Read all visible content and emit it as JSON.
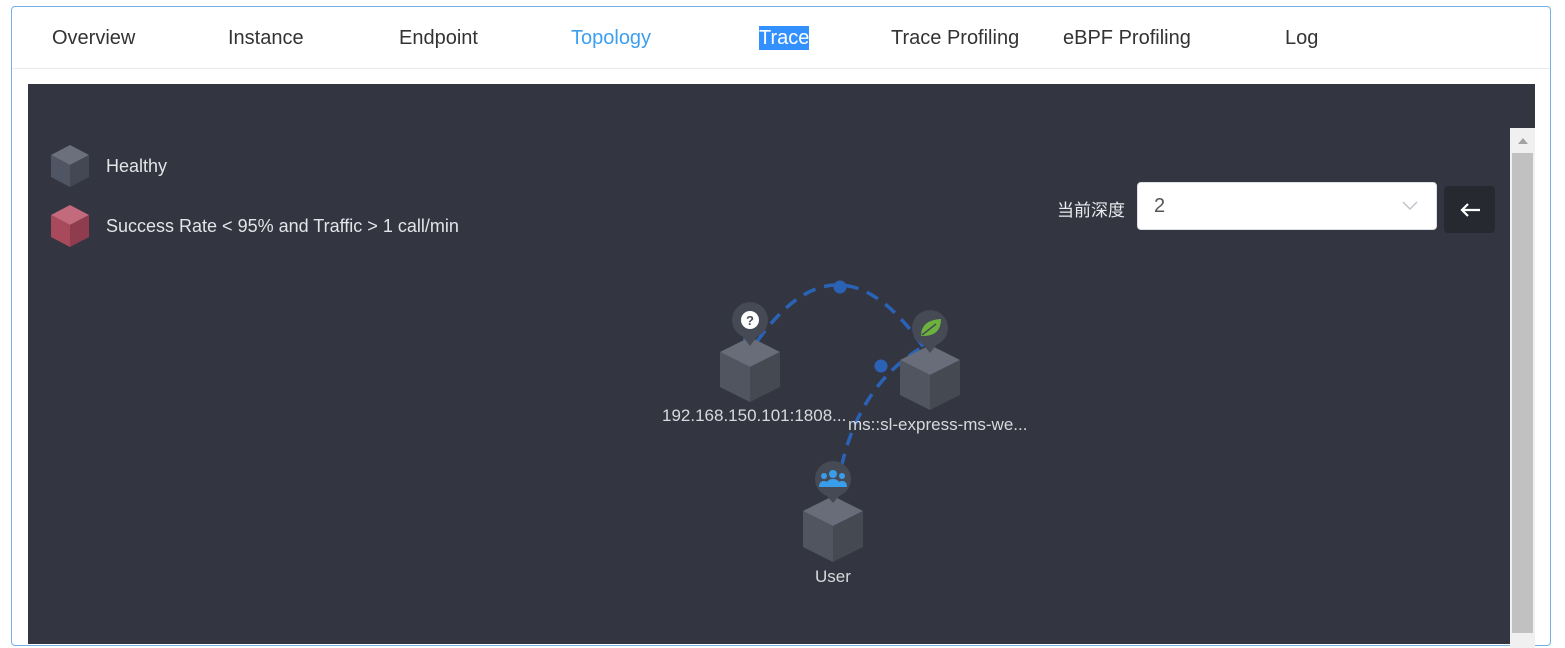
{
  "tabs": [
    {
      "label": "Overview"
    },
    {
      "label": "Instance"
    },
    {
      "label": "Endpoint"
    },
    {
      "label": "Topology",
      "state": "active"
    },
    {
      "label": "Trace",
      "state": "text-selected"
    },
    {
      "label": "Trace Profiling"
    },
    {
      "label": "eBPF Profiling"
    },
    {
      "label": "Log"
    }
  ],
  "legend": {
    "healthy": {
      "label": "Healthy",
      "color": "#4f5562"
    },
    "warning": {
      "label": "Success Rate < 95% and Traffic > 1 call/min",
      "color": "#a8495c"
    }
  },
  "depth": {
    "label": "当前深度",
    "value": "2"
  },
  "back_button": {
    "icon": "arrow-left-icon"
  },
  "topology": {
    "nodes": [
      {
        "name": "192.168.150.101:1808...",
        "icon": "question-icon"
      },
      {
        "name": "ms::sl-express-ms-we...",
        "icon": "spring-leaf-icon"
      },
      {
        "name": "User",
        "icon": "users-icon"
      }
    ],
    "edges": [
      {
        "from": "ms::sl-express-ms-we...",
        "to": "192.168.150.101:1808..."
      },
      {
        "from": "User",
        "to": "ms::sl-express-ms-we..."
      }
    ]
  },
  "colors": {
    "canvas_bg": "#333640",
    "edge": "#2a62b6",
    "active_tab": "#3d9ff0",
    "spring_icon": "#6cb33e",
    "users_icon": "#3a9de9"
  }
}
